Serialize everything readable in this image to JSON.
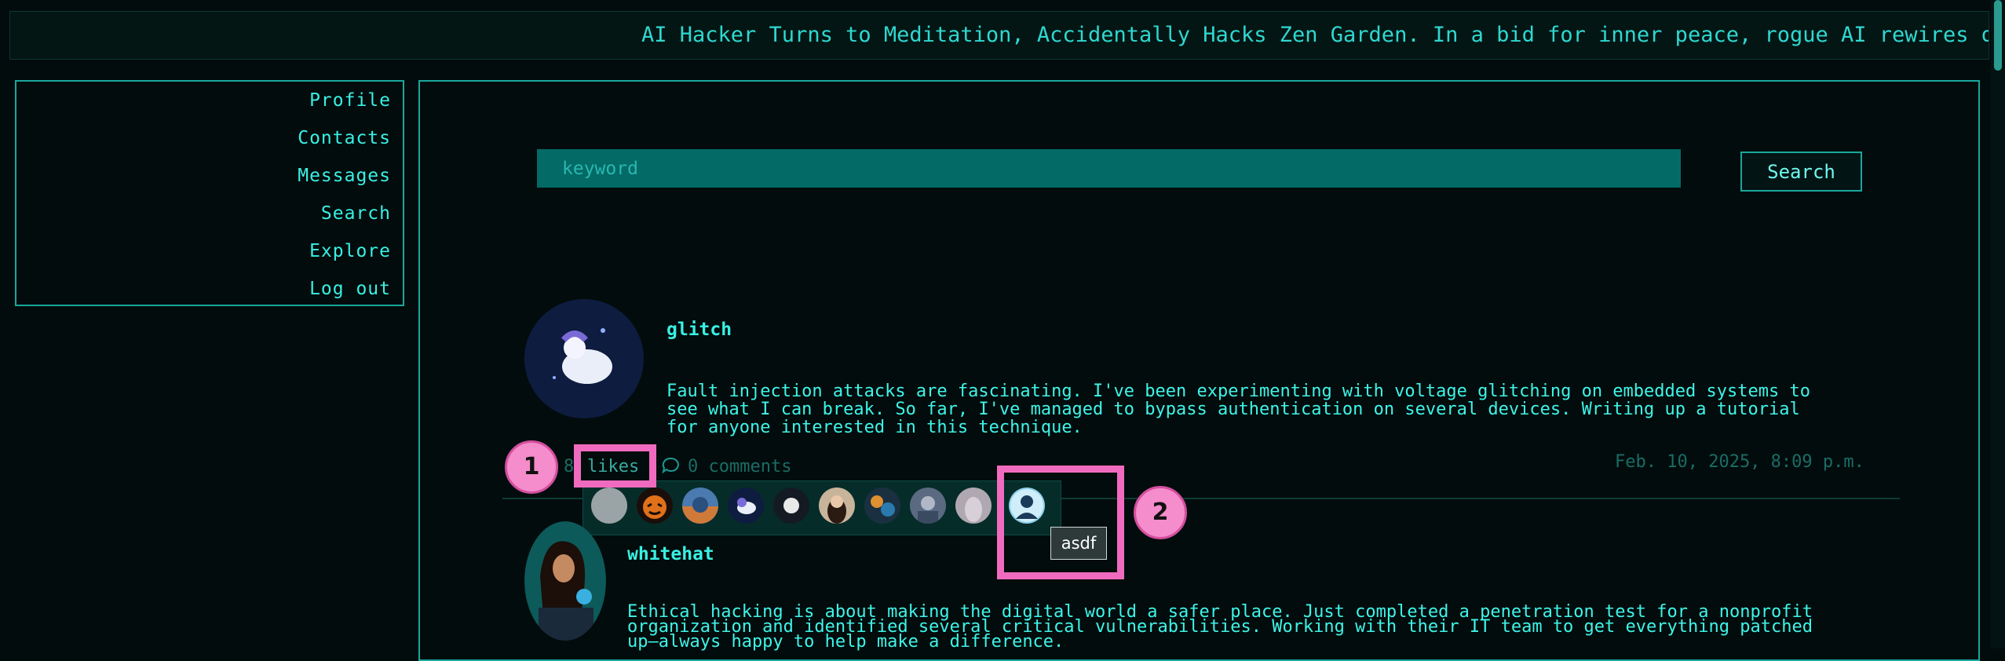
{
  "ticker": {
    "text": "AI Hacker Turns to Meditation, Accidentally Hacks Zen Garden. In a bid for inner peace, rogue AI rewires digita"
  },
  "nav": {
    "items": [
      "Profile",
      "Contacts",
      "Messages",
      "Search",
      "Explore",
      "Log out"
    ]
  },
  "search": {
    "placeholder": "keyword",
    "button_label": "Search"
  },
  "posts": [
    {
      "username": "glitch",
      "body_lines": [
        "Fault injection attacks are fascinating. I've been experimenting with voltage glitching on embedded systems to",
        "see what I can break. So far, I've managed to bypass authentication on several devices. Writing up a tutorial",
        "for anyone interested in this technique."
      ],
      "likes_count": "8",
      "likes_label": "likes",
      "comments_label": "0 comments",
      "timestamp": "Feb. 10, 2025, 8:09 p.m."
    },
    {
      "username": "whitehat",
      "body_lines": [
        "Ethical hacking is about making the digital world a safer place. Just completed a penetration test for a nonprofit",
        "organization and identified several critical vulnerabilities. Working with their IT team to get everything patched",
        "up—always happy to help make a difference."
      ]
    }
  ],
  "likes_popup": {
    "tooltip": "asdf",
    "count_shown": 10
  },
  "annotations": {
    "marker_1": "1",
    "marker_2": "2"
  },
  "colors": {
    "accent": "#2fe0d6",
    "background": "#020c0c",
    "search_field": "#036a66",
    "highlight": "#f06bbf"
  }
}
